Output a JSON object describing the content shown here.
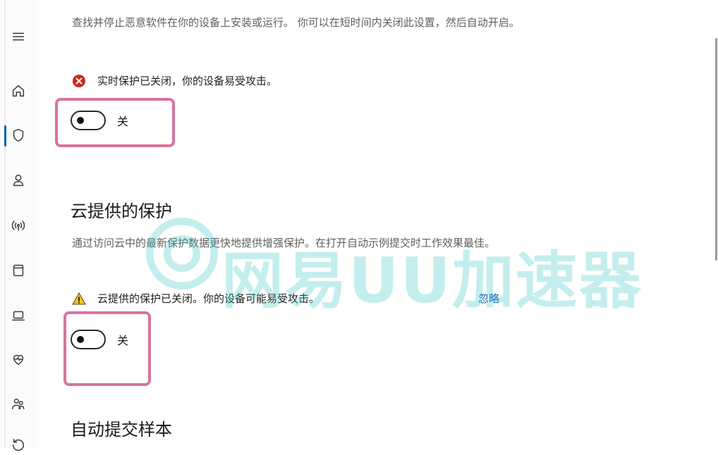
{
  "nav": {
    "icons": [
      "hamburger-menu-icon",
      "home-icon",
      "shield-icon",
      "person-icon",
      "wireless-icon",
      "app-window-icon",
      "laptop-icon",
      "heart-icon",
      "family-icon",
      "history-icon"
    ]
  },
  "realtime": {
    "description": "查找并停止恶意软件在你的设备上安装或运行。 你可以在短时间内关闭此设置，然后自动开启。",
    "status": "实时保护已关闭，你的设备易受攻击。",
    "toggle_state": "关"
  },
  "cloud": {
    "heading": "云提供的保护",
    "description": "通过访问云中的最新保护数据更快地提供增强保护。在打开自动示例提交时工作效果最佳。",
    "status": "云提供的保护已关闭。你的设备可能易受攻击。",
    "dismiss_link": "忽略",
    "toggle_state": "关"
  },
  "sample": {
    "heading": "自动提交样本"
  },
  "watermark": {
    "text": "网易UU加速器"
  },
  "colors": {
    "highlight": "#d9739d",
    "error": "#c42b1c",
    "warning": "#f7c325",
    "accent": "#005fb8",
    "watermark": "#2ec4c4"
  }
}
